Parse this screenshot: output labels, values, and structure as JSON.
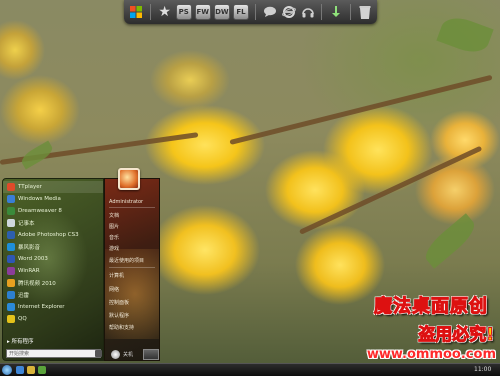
{
  "dock": {
    "items": [
      {
        "icon": "windows-logo-icon"
      },
      {
        "icon": "star-icon"
      },
      {
        "label": "PS"
      },
      {
        "label": "FW"
      },
      {
        "label": "DW"
      },
      {
        "label": "FL"
      },
      {
        "icon": "chat-bubble-icon"
      },
      {
        "icon": "internet-explorer-icon"
      },
      {
        "icon": "headphones-icon"
      },
      {
        "icon": "download-arrow-icon"
      },
      {
        "icon": "recycle-bin-icon"
      }
    ]
  },
  "start_menu": {
    "programs": [
      {
        "label": "TTplayer",
        "color": "#e04a2a"
      },
      {
        "label": "Windows Media",
        "color": "#3a7ed6"
      },
      {
        "label": "Dreamweaver 8",
        "color": "#3b8a3a"
      },
      {
        "label": "记事本",
        "color": "#cfd7de"
      },
      {
        "label": "Adobe Photoshop CS3",
        "color": "#2d5fae"
      },
      {
        "label": "暴风影音",
        "color": "#1e8fd9"
      },
      {
        "label": "Word 2003",
        "color": "#2e57b5"
      },
      {
        "label": "WinRAR",
        "color": "#8b3d9a"
      },
      {
        "label": "腾讯视频 2010",
        "color": "#e8a020"
      },
      {
        "label": "迅雷",
        "color": "#2d7fd0"
      },
      {
        "label": "Internet Explorer",
        "color": "#2b8ad8"
      },
      {
        "label": "QQ",
        "color": "#e4c21a"
      }
    ],
    "all_programs": "所有程序",
    "search_placeholder": "开始搜索",
    "right_links": [
      "Administrator",
      "文档",
      "图片",
      "音乐",
      "游戏",
      "最近使用的项目",
      "计算机",
      "网络",
      "控制面板",
      "默认程序",
      "帮助和支持"
    ],
    "power_label": "关机"
  },
  "taskbar": {
    "clock": "11:00"
  },
  "watermark": {
    "line1": "魔法桌面原创",
    "line2": "盗用必究!",
    "line3": "www.ommoo.com"
  }
}
